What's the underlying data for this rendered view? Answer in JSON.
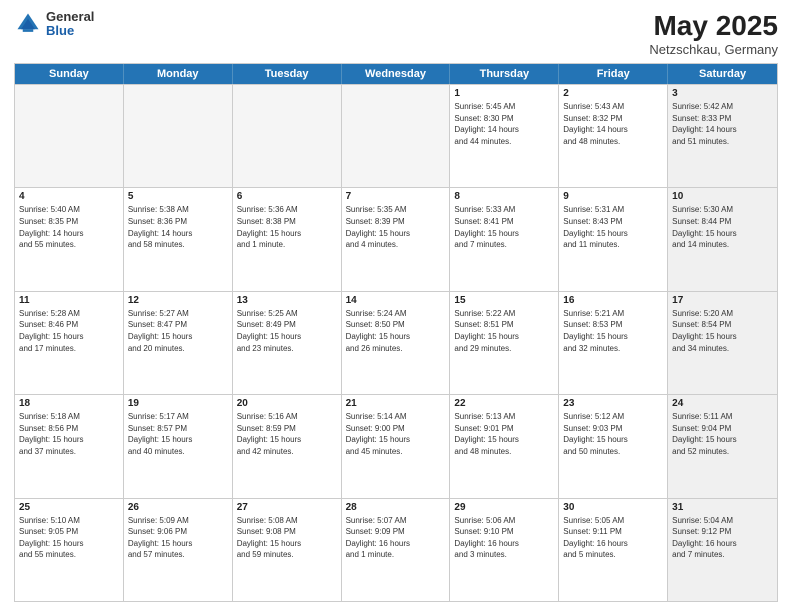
{
  "header": {
    "logo": {
      "general": "General",
      "blue": "Blue"
    },
    "title": "May 2025",
    "location": "Netzschkau, Germany"
  },
  "weekdays": [
    "Sunday",
    "Monday",
    "Tuesday",
    "Wednesday",
    "Thursday",
    "Friday",
    "Saturday"
  ],
  "weeks": [
    [
      {
        "day": "",
        "info": "",
        "empty": true
      },
      {
        "day": "",
        "info": "",
        "empty": true
      },
      {
        "day": "",
        "info": "",
        "empty": true
      },
      {
        "day": "",
        "info": "",
        "empty": true
      },
      {
        "day": "1",
        "info": "Sunrise: 5:45 AM\nSunset: 8:30 PM\nDaylight: 14 hours\nand 44 minutes.",
        "empty": false
      },
      {
        "day": "2",
        "info": "Sunrise: 5:43 AM\nSunset: 8:32 PM\nDaylight: 14 hours\nand 48 minutes.",
        "empty": false
      },
      {
        "day": "3",
        "info": "Sunrise: 5:42 AM\nSunset: 8:33 PM\nDaylight: 14 hours\nand 51 minutes.",
        "empty": false,
        "shaded": true
      }
    ],
    [
      {
        "day": "4",
        "info": "Sunrise: 5:40 AM\nSunset: 8:35 PM\nDaylight: 14 hours\nand 55 minutes.",
        "empty": false
      },
      {
        "day": "5",
        "info": "Sunrise: 5:38 AM\nSunset: 8:36 PM\nDaylight: 14 hours\nand 58 minutes.",
        "empty": false
      },
      {
        "day": "6",
        "info": "Sunrise: 5:36 AM\nSunset: 8:38 PM\nDaylight: 15 hours\nand 1 minute.",
        "empty": false
      },
      {
        "day": "7",
        "info": "Sunrise: 5:35 AM\nSunset: 8:39 PM\nDaylight: 15 hours\nand 4 minutes.",
        "empty": false
      },
      {
        "day": "8",
        "info": "Sunrise: 5:33 AM\nSunset: 8:41 PM\nDaylight: 15 hours\nand 7 minutes.",
        "empty": false
      },
      {
        "day": "9",
        "info": "Sunrise: 5:31 AM\nSunset: 8:43 PM\nDaylight: 15 hours\nand 11 minutes.",
        "empty": false
      },
      {
        "day": "10",
        "info": "Sunrise: 5:30 AM\nSunset: 8:44 PM\nDaylight: 15 hours\nand 14 minutes.",
        "empty": false,
        "shaded": true
      }
    ],
    [
      {
        "day": "11",
        "info": "Sunrise: 5:28 AM\nSunset: 8:46 PM\nDaylight: 15 hours\nand 17 minutes.",
        "empty": false
      },
      {
        "day": "12",
        "info": "Sunrise: 5:27 AM\nSunset: 8:47 PM\nDaylight: 15 hours\nand 20 minutes.",
        "empty": false
      },
      {
        "day": "13",
        "info": "Sunrise: 5:25 AM\nSunset: 8:49 PM\nDaylight: 15 hours\nand 23 minutes.",
        "empty": false
      },
      {
        "day": "14",
        "info": "Sunrise: 5:24 AM\nSunset: 8:50 PM\nDaylight: 15 hours\nand 26 minutes.",
        "empty": false
      },
      {
        "day": "15",
        "info": "Sunrise: 5:22 AM\nSunset: 8:51 PM\nDaylight: 15 hours\nand 29 minutes.",
        "empty": false
      },
      {
        "day": "16",
        "info": "Sunrise: 5:21 AM\nSunset: 8:53 PM\nDaylight: 15 hours\nand 32 minutes.",
        "empty": false
      },
      {
        "day": "17",
        "info": "Sunrise: 5:20 AM\nSunset: 8:54 PM\nDaylight: 15 hours\nand 34 minutes.",
        "empty": false,
        "shaded": true
      }
    ],
    [
      {
        "day": "18",
        "info": "Sunrise: 5:18 AM\nSunset: 8:56 PM\nDaylight: 15 hours\nand 37 minutes.",
        "empty": false
      },
      {
        "day": "19",
        "info": "Sunrise: 5:17 AM\nSunset: 8:57 PM\nDaylight: 15 hours\nand 40 minutes.",
        "empty": false
      },
      {
        "day": "20",
        "info": "Sunrise: 5:16 AM\nSunset: 8:59 PM\nDaylight: 15 hours\nand 42 minutes.",
        "empty": false
      },
      {
        "day": "21",
        "info": "Sunrise: 5:14 AM\nSunset: 9:00 PM\nDaylight: 15 hours\nand 45 minutes.",
        "empty": false
      },
      {
        "day": "22",
        "info": "Sunrise: 5:13 AM\nSunset: 9:01 PM\nDaylight: 15 hours\nand 48 minutes.",
        "empty": false
      },
      {
        "day": "23",
        "info": "Sunrise: 5:12 AM\nSunset: 9:03 PM\nDaylight: 15 hours\nand 50 minutes.",
        "empty": false
      },
      {
        "day": "24",
        "info": "Sunrise: 5:11 AM\nSunset: 9:04 PM\nDaylight: 15 hours\nand 52 minutes.",
        "empty": false,
        "shaded": true
      }
    ],
    [
      {
        "day": "25",
        "info": "Sunrise: 5:10 AM\nSunset: 9:05 PM\nDaylight: 15 hours\nand 55 minutes.",
        "empty": false
      },
      {
        "day": "26",
        "info": "Sunrise: 5:09 AM\nSunset: 9:06 PM\nDaylight: 15 hours\nand 57 minutes.",
        "empty": false
      },
      {
        "day": "27",
        "info": "Sunrise: 5:08 AM\nSunset: 9:08 PM\nDaylight: 15 hours\nand 59 minutes.",
        "empty": false
      },
      {
        "day": "28",
        "info": "Sunrise: 5:07 AM\nSunset: 9:09 PM\nDaylight: 16 hours\nand 1 minute.",
        "empty": false
      },
      {
        "day": "29",
        "info": "Sunrise: 5:06 AM\nSunset: 9:10 PM\nDaylight: 16 hours\nand 3 minutes.",
        "empty": false
      },
      {
        "day": "30",
        "info": "Sunrise: 5:05 AM\nSunset: 9:11 PM\nDaylight: 16 hours\nand 5 minutes.",
        "empty": false
      },
      {
        "day": "31",
        "info": "Sunrise: 5:04 AM\nSunset: 9:12 PM\nDaylight: 16 hours\nand 7 minutes.",
        "empty": false,
        "shaded": true
      }
    ]
  ]
}
